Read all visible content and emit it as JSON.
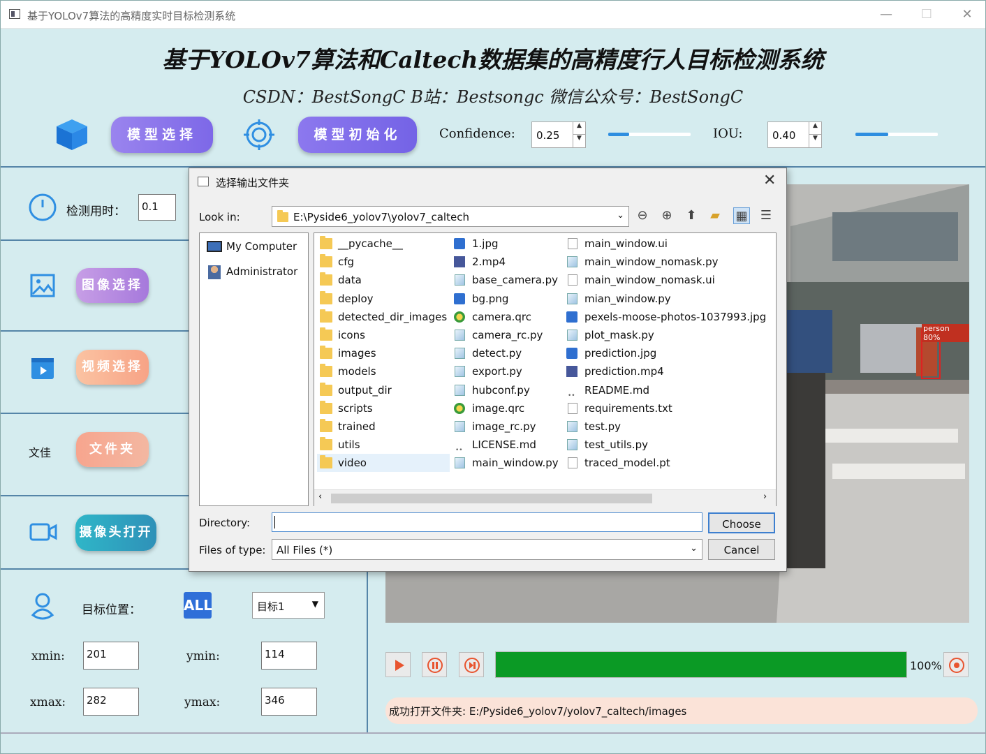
{
  "window": {
    "title": "基于YOLOv7算法的高精度实时目标检测系统",
    "minimize": "—",
    "maximize": "☐",
    "close": "✕"
  },
  "header": {
    "title": "基于YOLOv7算法和Caltech数据集的高精度行人目标检测系统",
    "subtitle": "CSDN：BestSongC   B站：Bestsongc   微信公众号：BestSongC"
  },
  "toolbar": {
    "model_select": "模型选择",
    "model_init": "模型初始化",
    "confidence_label": "Confidence:",
    "confidence_value": "0.25",
    "confidence_level": 0.25,
    "iou_label": "IOU:",
    "iou_value": "0.40",
    "iou_level": 0.4
  },
  "left_panel": {
    "detect_time_label": "检测用时：",
    "detect_time_value": "0.1",
    "image_select": "图像选择",
    "video_select": "视频选择",
    "folder_prefix": "文佳",
    "folder_select": "文件夹",
    "camera_open": "摄像头打开",
    "target_position_label": "目标位置：",
    "all_badge": "ALL",
    "target_combo": "目标1",
    "xmin_label": "xmin:",
    "xmin_value": "201",
    "ymin_label": "ymin:",
    "ymin_value": "114",
    "xmax_label": "xmax:",
    "xmax_value": "282",
    "ymax_label": "ymax:",
    "ymax_value": "346"
  },
  "video": {
    "detection_label": "person 80%"
  },
  "playback": {
    "progress_percent": 100,
    "progress_text": "100%"
  },
  "status": {
    "message": "成功打开文件夹: E:/Pyside6_yolov7/yolov7_caltech/images"
  },
  "dialog": {
    "title": "选择输出文件夹",
    "look_in_label": "Look in:",
    "look_in_path": "E:\\Pyside6_yolov7\\yolov7_caltech",
    "sidebar": [
      "My Computer",
      "Administrator"
    ],
    "columns": [
      [
        {
          "name": "__pycache__",
          "type": "folder"
        },
        {
          "name": "cfg",
          "type": "folder"
        },
        {
          "name": "data",
          "type": "folder"
        },
        {
          "name": "deploy",
          "type": "folder"
        },
        {
          "name": "detected_dir_images",
          "type": "folder"
        },
        {
          "name": "icons",
          "type": "folder"
        },
        {
          "name": "images",
          "type": "folder"
        },
        {
          "name": "models",
          "type": "folder"
        },
        {
          "name": "output_dir",
          "type": "folder"
        },
        {
          "name": "scripts",
          "type": "folder"
        },
        {
          "name": "trained",
          "type": "folder"
        },
        {
          "name": "utils",
          "type": "folder"
        },
        {
          "name": "video",
          "type": "folder"
        }
      ],
      [
        {
          "name": "1.jpg",
          "type": "img"
        },
        {
          "name": "2.mp4",
          "type": "mp4"
        },
        {
          "name": "base_camera.py",
          "type": "py"
        },
        {
          "name": "bg.png",
          "type": "img"
        },
        {
          "name": "camera.qrc",
          "type": "qrc"
        },
        {
          "name": "camera_rc.py",
          "type": "py"
        },
        {
          "name": "detect.py",
          "type": "py"
        },
        {
          "name": "export.py",
          "type": "py"
        },
        {
          "name": "hubconf.py",
          "type": "py"
        },
        {
          "name": "image.qrc",
          "type": "qrc"
        },
        {
          "name": "image_rc.py",
          "type": "py"
        },
        {
          "name": "LICENSE.md",
          "type": "md"
        },
        {
          "name": "main_window.py",
          "type": "py"
        }
      ],
      [
        {
          "name": "main_window.ui",
          "type": "doc"
        },
        {
          "name": "main_window_nomask.py",
          "type": "py"
        },
        {
          "name": "main_window_nomask.ui",
          "type": "doc"
        },
        {
          "name": "mian_window.py",
          "type": "py"
        },
        {
          "name": "pexels-moose-photos-1037993.jpg",
          "type": "img"
        },
        {
          "name": "plot_mask.py",
          "type": "py"
        },
        {
          "name": "prediction.jpg",
          "type": "img"
        },
        {
          "name": "prediction.mp4",
          "type": "mp4"
        },
        {
          "name": "README.md",
          "type": "md"
        },
        {
          "name": "requirements.txt",
          "type": "doc"
        },
        {
          "name": "test.py",
          "type": "py"
        },
        {
          "name": "test_utils.py",
          "type": "py"
        },
        {
          "name": "traced_model.pt",
          "type": "doc"
        }
      ]
    ],
    "directory_label": "Directory:",
    "directory_value": "",
    "files_of_type_label": "Files of type:",
    "files_of_type_value": "All Files (*)",
    "choose": "Choose",
    "cancel": "Cancel"
  },
  "colors": {
    "progress": "#0b9a25",
    "accent": "#2e8ee0",
    "status_bg": "#fbe3d8"
  }
}
